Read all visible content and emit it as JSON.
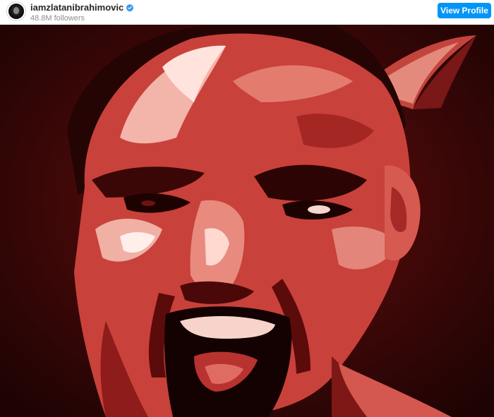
{
  "post": {
    "username": "iamzlatanibrahimovic",
    "followers": "48.8M followers",
    "view_profile_label": "View Profile"
  },
  "icons": {
    "avatar": "profile-avatar",
    "verified": "verified-badge-icon"
  },
  "colors": {
    "button": "#0095f6",
    "verified": "#3897f0",
    "artwork_dark": "#3a0606",
    "artwork_mid": "#b22a2a",
    "artwork_light": "#f2b8b0"
  }
}
